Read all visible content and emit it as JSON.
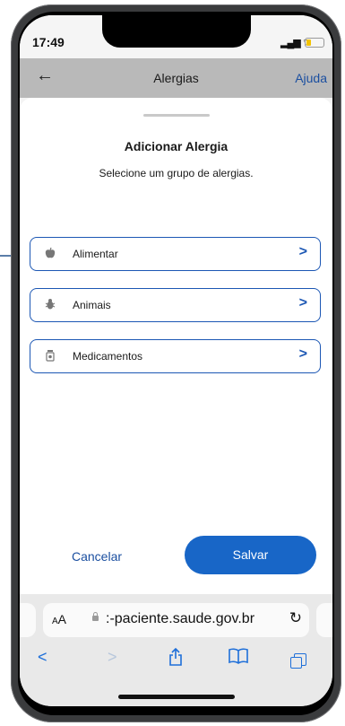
{
  "status_bar": {
    "time": "17:49"
  },
  "nav": {
    "title": "Alergias",
    "help": "Ajuda"
  },
  "sheet": {
    "title": "Adicionar Alergia",
    "subtitle": "Selecione um grupo de alergias.",
    "options": [
      {
        "label": "Alimentar",
        "icon": "apple-icon"
      },
      {
        "label": "Animais",
        "icon": "bug-icon"
      },
      {
        "label": "Medicamentos",
        "icon": "pill-bottle-icon"
      }
    ],
    "cancel_label": "Cancelar",
    "save_label": "Salvar"
  },
  "browser": {
    "text_size": "AA",
    "url": ":-paciente.saude.gov.br"
  },
  "colors": {
    "accent": "#1866c7",
    "link": "#1b4fa0",
    "safari_blue": "#1e6fd9"
  }
}
